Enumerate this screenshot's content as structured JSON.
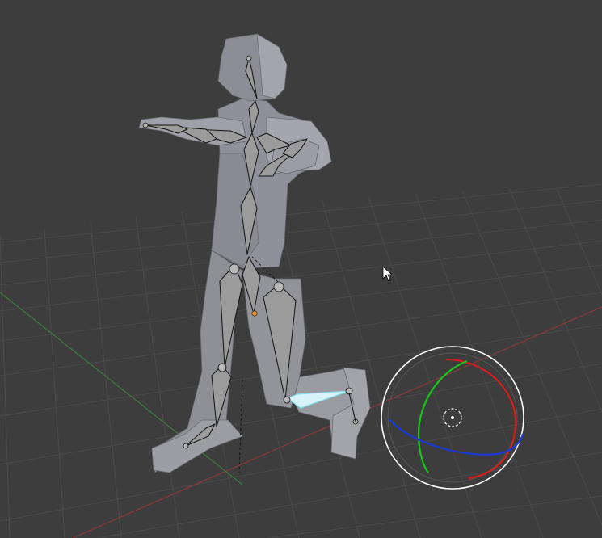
{
  "viewport": {
    "mode": "pose",
    "background_color": "#3d3d3d",
    "grid_color": "#4a4a4a",
    "x_axis_color": "#8a3a3a",
    "y_axis_color": "#3e7a3e"
  },
  "model": {
    "mesh_color": "#8e8e95",
    "bone_color": "#9b9b9b",
    "bone_outline_color": "#111111",
    "selected_bone_color": "#87dff0",
    "pivot_color": "#e8902a"
  },
  "rotate_gizmo": {
    "x_ring_color": "#d21e1e",
    "y_ring_color": "#18c418",
    "z_ring_color": "#1a38d6",
    "view_ring_color": "#ffffff",
    "trackball_color": "#555555"
  },
  "cursor": {
    "icon": "mouse-pointer-icon"
  }
}
